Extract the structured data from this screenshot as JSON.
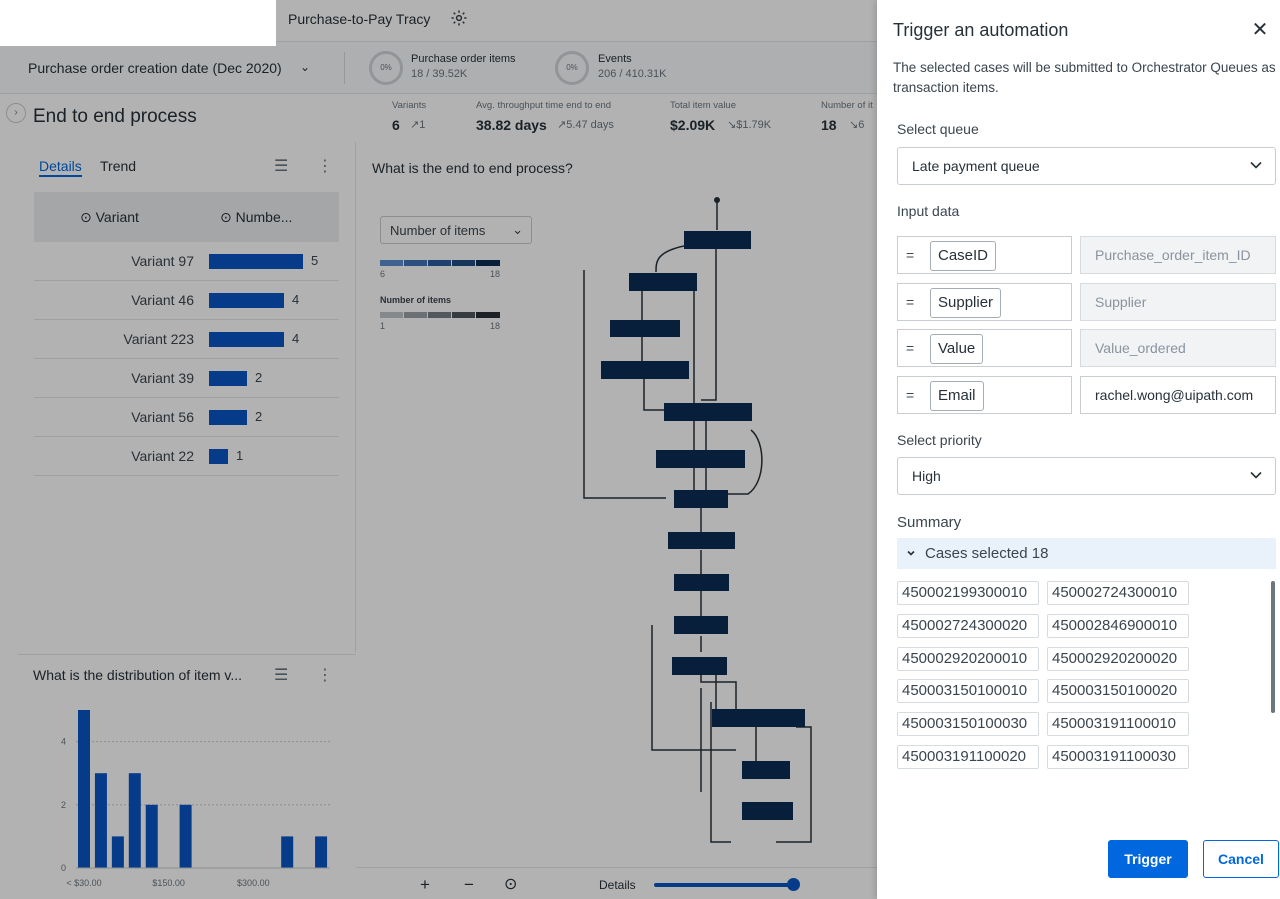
{
  "app": {
    "title": "Purchase-to-Pay Tracy",
    "date_filter": "Purchase order creation date (Dec 2020)",
    "metrics": [
      {
        "percent": "0%",
        "label": "Purchase order items",
        "value": "18 / 39.52K"
      },
      {
        "percent": "0%",
        "label": "Events",
        "value": "206 / 410.31K"
      }
    ],
    "process_title": "End to end process",
    "kpis": [
      {
        "label": "Variants",
        "value": "6",
        "trend": "1"
      },
      {
        "label": "Avg. throughput time end to end",
        "value": "38.82 days",
        "trend": "5.47 days"
      },
      {
        "label": "Total item value",
        "value": "$2.09K",
        "trend": "$1.79K"
      },
      {
        "label": "Number of it",
        "value": "18",
        "trend": "6"
      }
    ],
    "tabs": [
      "Details",
      "Trend"
    ],
    "table_headers": [
      "Variant",
      "Numbe..."
    ],
    "variants": [
      {
        "name": "Variant 97",
        "count": 5
      },
      {
        "name": "Variant 46",
        "count": 4
      },
      {
        "name": "Variant 223",
        "count": 4
      },
      {
        "name": "Variant 39",
        "count": 2
      },
      {
        "name": "Variant 56",
        "count": 2
      },
      {
        "name": "Variant 22",
        "count": 1
      }
    ],
    "dist_title": "What is the distribution of item v...",
    "center_question": "What is the end to end process?",
    "items_dropdown": "Number of items",
    "legend_top": {
      "min": "6",
      "max": "18"
    },
    "legend_bottom": {
      "title": "Number of items",
      "min": "1",
      "max": "18"
    },
    "bottom_label": "Details"
  },
  "chart_data": {
    "type": "bar",
    "title": "What is the distribution of item v...",
    "xlabel": "",
    "ylabel": "",
    "x_tick_labels": [
      "< $30.00",
      "$150.00",
      "$300.00"
    ],
    "y_ticks": [
      0,
      2,
      4
    ],
    "ylim": [
      0,
      5
    ],
    "values": [
      5,
      3,
      1,
      3,
      2,
      0,
      2,
      0,
      0,
      0,
      0,
      0,
      1,
      0,
      1
    ],
    "color": "#0a55c4",
    "grid": true
  },
  "drawer": {
    "title": "Trigger an automation",
    "description": "The selected cases will be submitted to Orchestrator Queues as transaction items.",
    "queue_label": "Select queue",
    "queue_value": "Late payment queue",
    "input_label": "Input data",
    "inputs": [
      {
        "field": "CaseID",
        "value": "Purchase_order_item_ID",
        "placeholder": true
      },
      {
        "field": "Supplier",
        "value": "Supplier",
        "placeholder": true
      },
      {
        "field": "Value",
        "value": "Value_ordered",
        "placeholder": true
      },
      {
        "field": "Email",
        "value": "rachel.wong@uipath.com",
        "placeholder": false
      }
    ],
    "eq": "=",
    "priority_label": "Select priority",
    "priority_value": "High",
    "summary_label": "Summary",
    "cases_header": "Cases selected 18",
    "cases": [
      "450002199300010",
      "450002724300010",
      "450002724300020",
      "450002846900010",
      "450002920200010",
      "450002920200020",
      "450003150100010",
      "450003150100020",
      "450003150100030",
      "450003191100010",
      "450003191100020",
      "450003191100030"
    ],
    "trigger_label": "Trigger",
    "cancel_label": "Cancel"
  }
}
